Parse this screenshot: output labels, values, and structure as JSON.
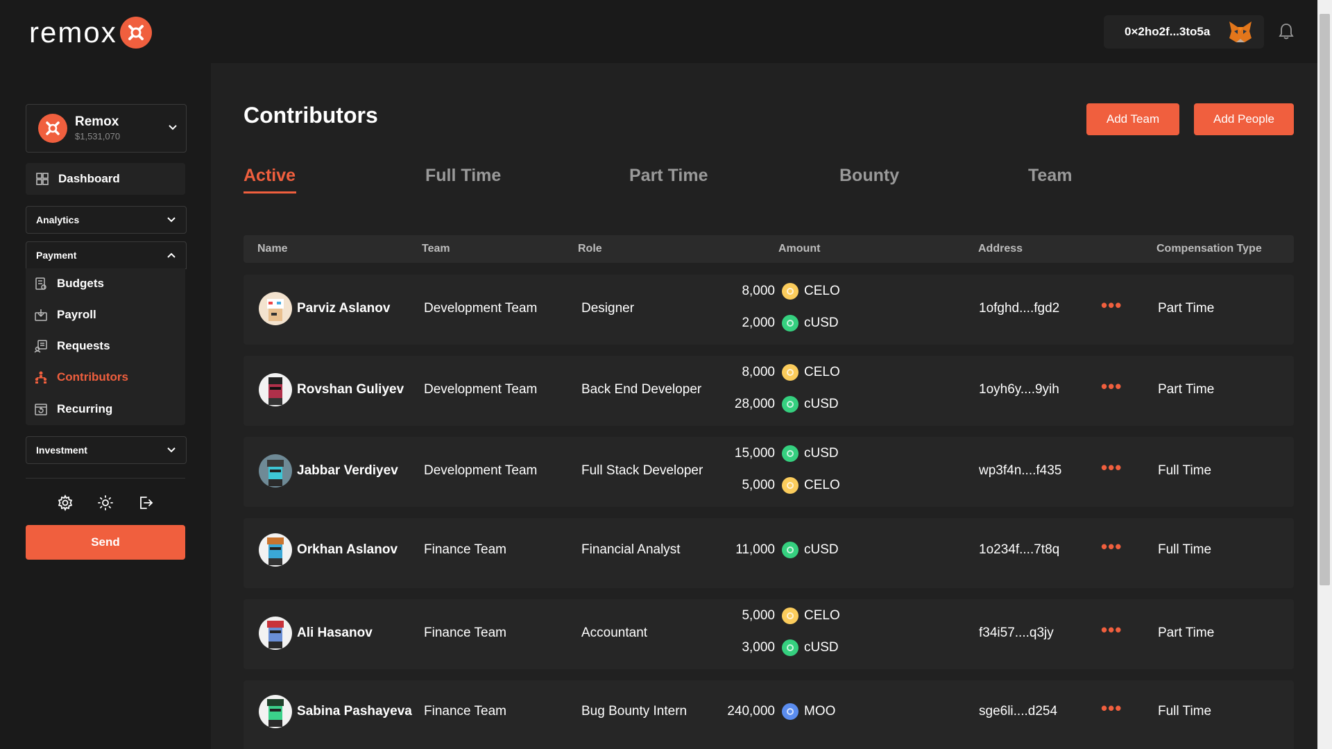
{
  "brand": {
    "logo_text": "remox"
  },
  "header": {
    "wallet_address": "0×2ho2f...3to5a"
  },
  "account": {
    "name": "Remox",
    "balance": "$1,531,070"
  },
  "sidebar": {
    "dashboard": "Dashboard",
    "analytics": "Analytics",
    "payment": "Payment",
    "payment_items": [
      "Budgets",
      "Payroll",
      "Requests",
      "Contributors",
      "Recurring"
    ],
    "active_item": "Contributors",
    "investment": "Investment",
    "send_label": "Send"
  },
  "main": {
    "title": "Contributors",
    "add_team": "Add Team",
    "add_people": "Add People",
    "tabs": [
      "Active",
      "Full Time",
      "Part Time",
      "Bounty",
      "Team"
    ],
    "active_tab": "Active"
  },
  "table": {
    "columns": [
      "Name",
      "Team",
      "Role",
      "Amount",
      "Address",
      "Compensation Type"
    ],
    "rows": [
      {
        "name": "Parviz Aslanov",
        "team": "Development Team",
        "role": "Designer",
        "amounts": [
          {
            "value": "8,000",
            "token": "CELO"
          },
          {
            "value": "2,000",
            "token": "cUSD"
          }
        ],
        "address": "1ofghd....fgd2",
        "comp": "Part Time"
      },
      {
        "name": "Rovshan Guliyev",
        "team": "Development Team",
        "role": "Back End Developer",
        "amounts": [
          {
            "value": "8,000",
            "token": "CELO"
          },
          {
            "value": "28,000",
            "token": "cUSD"
          }
        ],
        "address": "1oyh6y....9yih",
        "comp": "Part Time"
      },
      {
        "name": "Jabbar Verdiyev",
        "team": "Development Team",
        "role": "Full Stack Developer",
        "amounts": [
          {
            "value": "15,000",
            "token": "cUSD"
          },
          {
            "value": "5,000",
            "token": "CELO"
          }
        ],
        "address": "wp3f4n....f435",
        "comp": "Full Time"
      },
      {
        "name": "Orkhan Aslanov",
        "team": "Finance Team",
        "role": "Financial Analyst",
        "amounts": [
          {
            "value": "11,000",
            "token": "cUSD"
          }
        ],
        "address": "1o234f....7t8q",
        "comp": "Full Time"
      },
      {
        "name": "Ali Hasanov",
        "team": "Finance Team",
        "role": "Accountant",
        "amounts": [
          {
            "value": "5,000",
            "token": "CELO"
          },
          {
            "value": "3,000",
            "token": "cUSD"
          }
        ],
        "address": "f34i57....q3jy",
        "comp": "Part Time"
      },
      {
        "name": "Sabina Pashayeva",
        "team": "Finance Team",
        "role": "Bug Bounty Intern",
        "amounts": [
          {
            "value": "240,000",
            "token": "MOO"
          }
        ],
        "address": "sge6li....d254",
        "comp": "Full Time"
      }
    ]
  },
  "colors": {
    "accent": "#f05f3e",
    "celo": "#fbcc5c",
    "cusd": "#35d07f",
    "moo": "#5b8def"
  }
}
